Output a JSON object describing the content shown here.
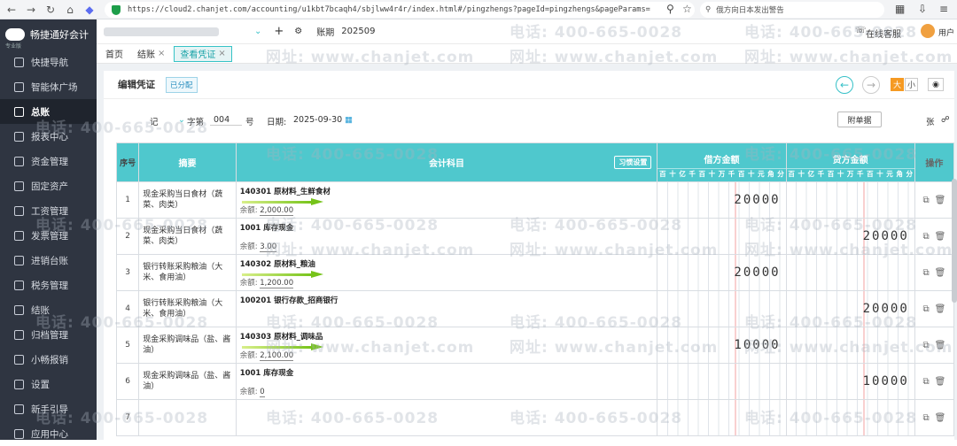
{
  "browser": {
    "url": "https://cloud2.chanjet.com/accounting/u1kbt7bcaqh4/sbjlww4r4r/index.html#/pingzhengs?pageId=pingzhengs&pageParams=",
    "search_placeholder": "俄方向日本发出警告"
  },
  "app": {
    "logo_text": "畅捷通好会计",
    "logo_sub": "专业版"
  },
  "sidebar": {
    "items": [
      {
        "label": "快捷导航",
        "icon": "home-icon"
      },
      {
        "label": "智能体广场",
        "icon": "bulb-icon"
      },
      {
        "label": "总账",
        "icon": "ledger-icon"
      },
      {
        "label": "报表中心",
        "icon": "chart-icon"
      },
      {
        "label": "资金管理",
        "icon": "money-icon"
      },
      {
        "label": "固定资产",
        "icon": "asset-icon"
      },
      {
        "label": "工资管理",
        "icon": "salary-icon"
      },
      {
        "label": "发票管理",
        "icon": "invoice-icon"
      },
      {
        "label": "进销台账",
        "icon": "stock-icon"
      },
      {
        "label": "税务管理",
        "icon": "tax-icon"
      },
      {
        "label": "结账",
        "icon": "close-book-icon"
      },
      {
        "label": "归档管理",
        "icon": "archive-icon"
      },
      {
        "label": "小畅报销",
        "icon": "g-icon"
      },
      {
        "label": "设置",
        "icon": "gear-icon"
      },
      {
        "label": "新手引导",
        "icon": "play-icon"
      },
      {
        "label": "应用中心",
        "icon": "apps-icon"
      }
    ],
    "active_index": 2
  },
  "topbar": {
    "period_label": "账期",
    "period": "202509",
    "service": "在线客服",
    "user": "用户"
  },
  "tabs": [
    {
      "label": "首页"
    },
    {
      "label": "结账"
    },
    {
      "label": "查看凭证"
    }
  ],
  "voucher": {
    "title": "编辑凭证",
    "status": "已分配",
    "size_big": "大",
    "size_small": "小",
    "type_label": "记",
    "word_label": "字第",
    "number": "004",
    "number_suffix": "号",
    "date_label": "日期:",
    "date": "2025-09-30",
    "attach_label": "附单据",
    "attach_unit": "张",
    "cols": {
      "seq": "序号",
      "summary": "摘要",
      "account": "会计科目",
      "debit": "借方金额",
      "credit": "贷方金额",
      "op": "操作",
      "settings": "习惯设置"
    },
    "digits": [
      "百",
      "十",
      "亿",
      "千",
      "百",
      "十",
      "万",
      "千",
      "百",
      "十",
      "元",
      "角",
      "分"
    ],
    "balance_label": "余额:",
    "rows": [
      {
        "seq": "1",
        "summary": "现金采购当日食材（蔬菜、肉类）",
        "account": "140301 原材料_生鲜食材",
        "balance": "2,000.00",
        "debit": "20000",
        "credit": "",
        "arrow": true
      },
      {
        "seq": "2",
        "summary": "现金采购当日食材（蔬菜、肉类）",
        "account": "1001 库存现金",
        "balance": "3.00",
        "debit": "",
        "credit": "20000",
        "arrow": false
      },
      {
        "seq": "3",
        "summary": "银行转账采购粮油（大米、食用油）",
        "account": "140302 原材料_粮油",
        "balance": "1,200.00",
        "debit": "20000",
        "credit": "",
        "arrow": true
      },
      {
        "seq": "4",
        "summary": "银行转账采购粮油（大米、食用油）",
        "account": "100201 银行存款_招商银行",
        "balance": "",
        "debit": "",
        "credit": "20000",
        "arrow": false
      },
      {
        "seq": "5",
        "summary": "现金采购调味品（盐、酱油）",
        "account": "140303 原材料_调味品",
        "balance": "2,100.00",
        "debit": "10000",
        "credit": "",
        "arrow": true
      },
      {
        "seq": "6",
        "summary": "现金采购调味品（盐、酱油）",
        "account": "1001 库存现金",
        "balance": "0",
        "debit": "",
        "credit": "10000",
        "arrow": false
      },
      {
        "seq": "7",
        "summary": "",
        "account": "",
        "balance": "",
        "debit": "",
        "credit": "",
        "arrow": false
      }
    ]
  },
  "watermark": {
    "phone": "电话: 400-665-0028",
    "site": "网址: www.chanjet.com"
  }
}
